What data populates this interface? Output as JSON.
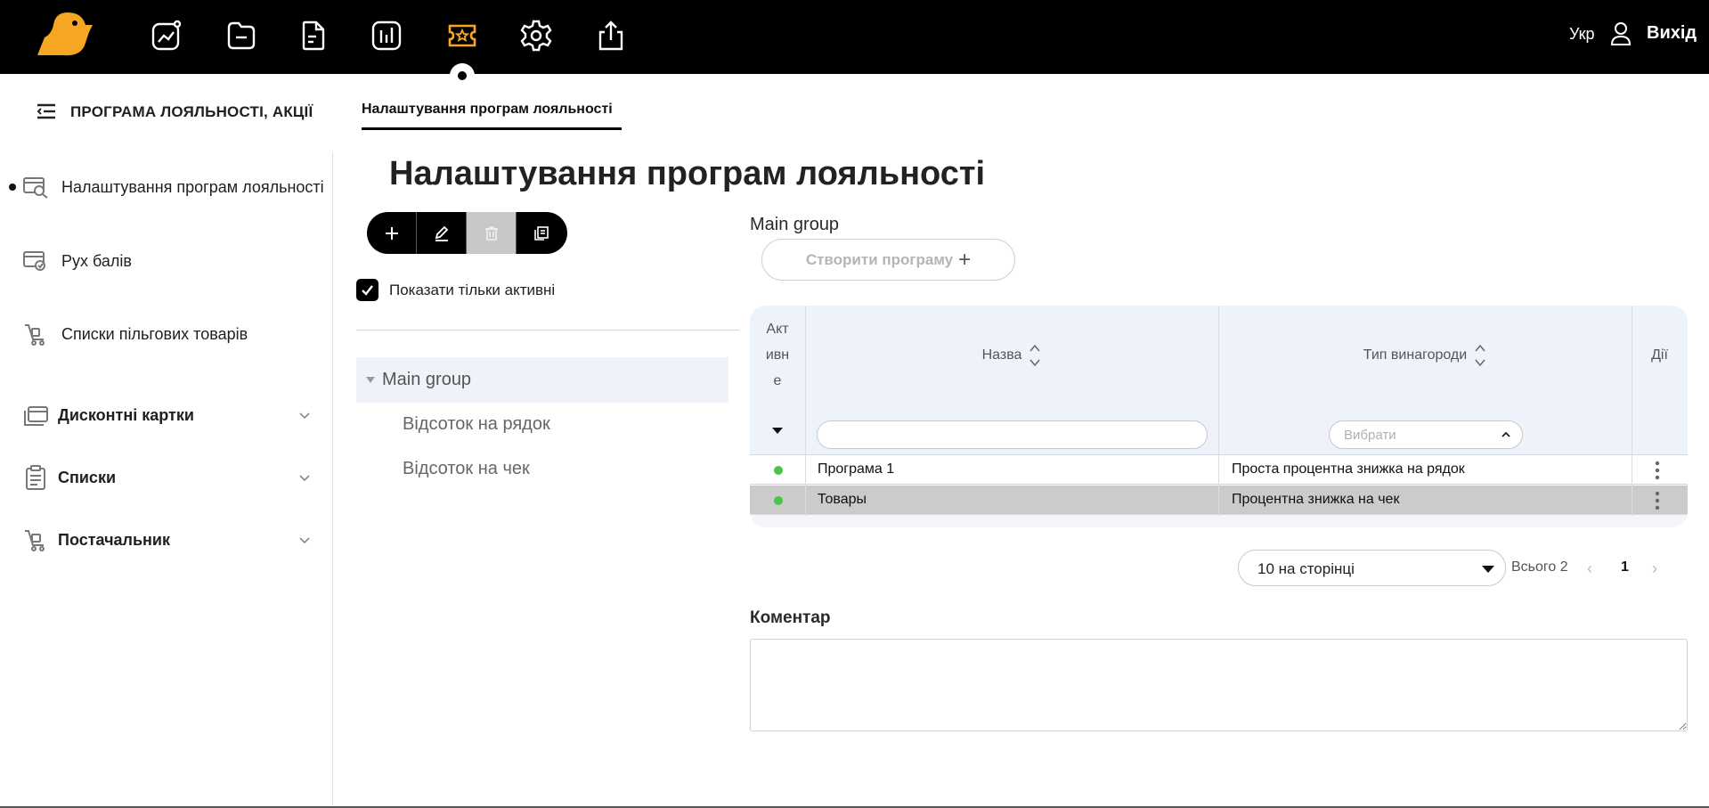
{
  "topbar": {
    "language": "Укр",
    "logout_label": "Вихід",
    "nav_icons": [
      "analytics-icon",
      "folder-icon",
      "document-icon",
      "reports-icon",
      "loyalty-ticket-icon",
      "settings-icon",
      "export-icon"
    ],
    "active_icon": "loyalty-ticket-icon",
    "accent_color": "#f5a623"
  },
  "subheader": {
    "section_title": "ПРОГРАМА ЛОЯЛЬНОСТІ, АКЦІЇ",
    "active_tab": "Налаштування програм лояльності"
  },
  "sidebar": {
    "items": [
      {
        "label": "Налаштування програм лояльності",
        "icon": "loyalty-settings-icon",
        "active": true
      },
      {
        "label": "Рух балів",
        "icon": "points-flow-icon"
      },
      {
        "label": "Списки пільгових товарів",
        "icon": "cart-list-icon"
      }
    ],
    "groups": [
      {
        "label": "Дисконтні картки",
        "icon": "cards-icon"
      },
      {
        "label": "Списки",
        "icon": "clipboard-icon"
      },
      {
        "label": "Постачальник",
        "icon": "supplier-cart-icon"
      }
    ]
  },
  "main": {
    "page_title": "Налаштування програм лояльності",
    "toolbar": [
      "add-icon",
      "edit-icon",
      "delete-icon",
      "copy-icon"
    ],
    "show_active_only_label": "Показати тільки активні",
    "show_active_only_checked": true,
    "tree": {
      "root": "Main group",
      "children": [
        "Відсоток на рядок",
        "Відсоток на чек"
      ]
    }
  },
  "panel": {
    "group_title": "Main group",
    "create_label": "Створити програму",
    "table": {
      "headers": {
        "active": [
          "Акт",
          "ивн",
          "е"
        ],
        "name": "Назва",
        "reward_type": "Тип винагороди",
        "actions": "Дії"
      },
      "filter_select_placeholder": "Вибрати",
      "rows": [
        {
          "active": true,
          "name": "Програма 1",
          "reward_type": "Проста процентна знижка на рядок"
        },
        {
          "active": true,
          "name": "Товары",
          "reward_type": "Процентна знижка на чек"
        }
      ]
    },
    "pagination": {
      "page_size": "10 на сторінці",
      "total": "Всього 2",
      "current_page": "1",
      "prev": "‹",
      "next": "›"
    },
    "comment_label": "Коментар"
  }
}
